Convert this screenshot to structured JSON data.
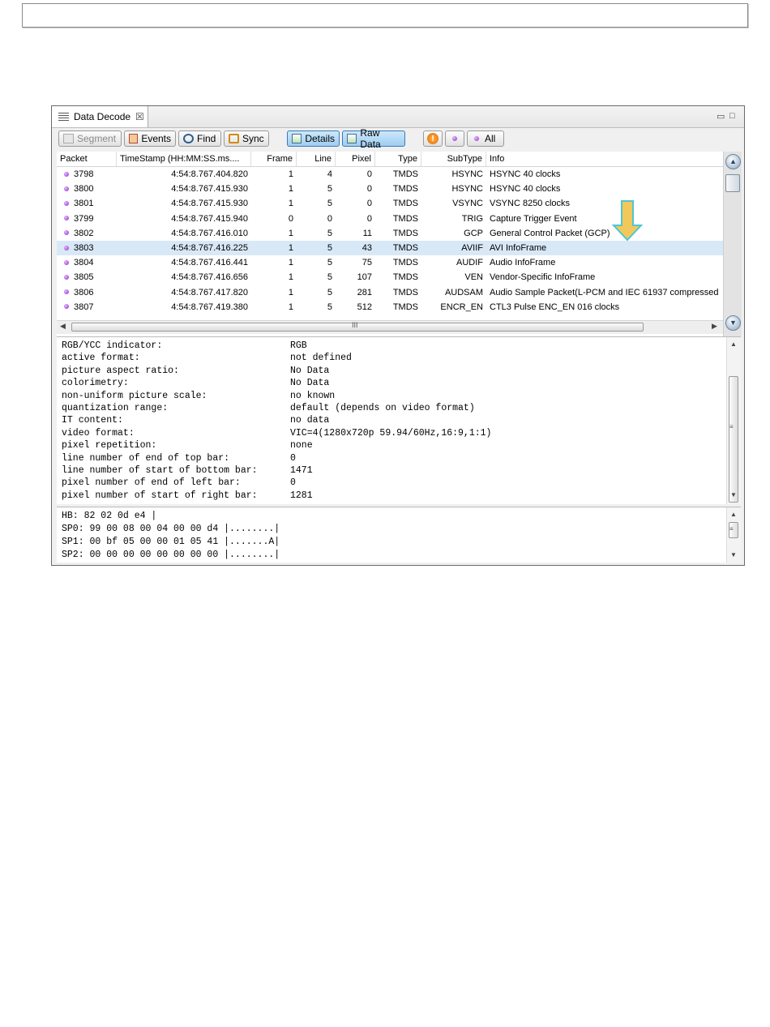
{
  "panel": {
    "title": "Data Decode",
    "close_glyph": "☒",
    "minimize_glyph": "▭",
    "maximize_glyph": "□"
  },
  "toolbar": {
    "segment_label": "Segment",
    "events_label": "Events",
    "find_label": "Find",
    "sync_label": "Sync",
    "details_label": "Details",
    "rawdata_label": "Raw Data",
    "alert_glyph": "!",
    "all_label": "All"
  },
  "table": {
    "headers": {
      "packet": "Packet",
      "timestamp": "TimeStamp (HH:MM:SS.ms....",
      "frame": "Frame",
      "line": "Line",
      "pixel": "Pixel",
      "type": "Type",
      "subtype": "SubType",
      "info": "Info"
    },
    "rows": [
      {
        "packet": "3798",
        "timestamp": "4:54:8.767.404.820",
        "frame": "1",
        "line": "4",
        "pixel": "0",
        "type": "TMDS",
        "subtype": "HSYNC",
        "info": "HSYNC 40 clocks"
      },
      {
        "packet": "3800",
        "timestamp": "4:54:8.767.415.930",
        "frame": "1",
        "line": "5",
        "pixel": "0",
        "type": "TMDS",
        "subtype": "HSYNC",
        "info": "HSYNC 40 clocks"
      },
      {
        "packet": "3801",
        "timestamp": "4:54:8.767.415.930",
        "frame": "1",
        "line": "5",
        "pixel": "0",
        "type": "TMDS",
        "subtype": "VSYNC",
        "info": "VSYNC 8250 clocks"
      },
      {
        "packet": "3799",
        "timestamp": "4:54:8.767.415.940",
        "frame": "0",
        "line": "0",
        "pixel": "0",
        "type": "TMDS",
        "subtype": "TRIG",
        "info": "Capture Trigger Event"
      },
      {
        "packet": "3802",
        "timestamp": "4:54:8.767.416.010",
        "frame": "1",
        "line": "5",
        "pixel": "11",
        "type": "TMDS",
        "subtype": "GCP",
        "info": "General Control Packet (GCP)"
      },
      {
        "packet": "3803",
        "timestamp": "4:54:8.767.416.225",
        "frame": "1",
        "line": "5",
        "pixel": "43",
        "type": "TMDS",
        "subtype": "AVIIF",
        "info": "AVI InfoFrame"
      },
      {
        "packet": "3804",
        "timestamp": "4:54:8.767.416.441",
        "frame": "1",
        "line": "5",
        "pixel": "75",
        "type": "TMDS",
        "subtype": "AUDIF",
        "info": "Audio InfoFrame"
      },
      {
        "packet": "3805",
        "timestamp": "4:54:8.767.416.656",
        "frame": "1",
        "line": "5",
        "pixel": "107",
        "type": "TMDS",
        "subtype": "VEN",
        "info": "Vendor-Specific InfoFrame"
      },
      {
        "packet": "3806",
        "timestamp": "4:54:8.767.417.820",
        "frame": "1",
        "line": "5",
        "pixel": "281",
        "type": "TMDS",
        "subtype": "AUDSAM",
        "info": "Audio Sample Packet(L-PCM and IEC 61937 compressed"
      },
      {
        "packet": "3807",
        "timestamp": "4:54:8.767.419.380",
        "frame": "1",
        "line": "5",
        "pixel": "512",
        "type": "TMDS",
        "subtype": "ENCR_EN",
        "info": "CTL3 Pulse ENC_EN 016 clocks"
      }
    ],
    "selected_packet": "3803"
  },
  "details": [
    {
      "label": "RGB/YCC indicator:",
      "value": "RGB"
    },
    {
      "label": "active format:",
      "value": "not defined"
    },
    {
      "label": "picture aspect ratio:",
      "value": "No Data"
    },
    {
      "label": "colorimetry:",
      "value": "No Data"
    },
    {
      "label": "non-uniform picture scale:",
      "value": "no known"
    },
    {
      "label": "quantization range:",
      "value": "default (depends on video format)"
    },
    {
      "label": "IT content:",
      "value": "no data"
    },
    {
      "label": "video format:",
      "value": "VIC=4(1280x720p 59.94/60Hz,16:9,1:1)"
    },
    {
      "label": "pixel repetition:",
      "value": "none"
    },
    {
      "label": "line number of end of top bar:",
      "value": "0"
    },
    {
      "label": "line number of start of bottom bar:",
      "value": "1471"
    },
    {
      "label": "pixel number of end of left bar:",
      "value": "0"
    },
    {
      "label": "pixel number of start of right bar:",
      "value": "1281"
    }
  ],
  "raw_data": [
    "HB: 82 02 0d e4 |",
    "SP0: 99 00 08 00 04 00 00 d4 |........|",
    "SP1: 00 bf 05 00 00 01 05 41 |.......A|",
    "SP2: 00 00 00 00 00 00 00 00 |........|"
  ],
  "colors": {
    "selected_row": "#d8e8f7",
    "active_button": "#9fcdf0",
    "packet_dot": "#8a2fc8",
    "arrow_fill": "#f2c85a",
    "arrow_stroke": "#4cc6d6"
  },
  "icons": {
    "scroll_up": "▲",
    "scroll_down": "▼",
    "scroll_left": "◀",
    "scroll_right": "▶",
    "grip": "≡",
    "hgrip": "III",
    "sync_glyph": "⇵"
  }
}
